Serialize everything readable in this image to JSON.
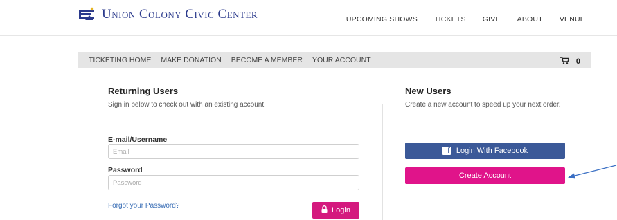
{
  "header": {
    "logo_text": "Union Colony Civic Center",
    "brand_color": "#2b3a8c",
    "nav": [
      "UPCOMING SHOWS",
      "TICKETS",
      "GIVE",
      "ABOUT",
      "VENUE"
    ]
  },
  "ticket_bar": {
    "items": [
      "TICKETING HOME",
      "MAKE DONATION",
      "BECOME A MEMBER",
      "YOUR ACCOUNT"
    ],
    "cart_icon": "cart-icon",
    "cart_count": "0"
  },
  "returning": {
    "title": "Returning Users",
    "subtitle": "Sign in below to check out with an existing account.",
    "email_label": "E-mail/Username",
    "email_placeholder": "Email",
    "password_label": "Password",
    "password_placeholder": "Password",
    "forgot_label": "Forgot your Password?",
    "login_label": "Login",
    "login_icon": "lock-icon",
    "accent_color": "#d4197e"
  },
  "new_users": {
    "title": "New Users",
    "subtitle": "Create a new account to speed up your next order.",
    "facebook_label": "Login With Facebook",
    "facebook_color": "#3b5998",
    "create_label": "Create Account",
    "create_color": "#e0148a"
  },
  "annotation": {
    "arrow_icon": "arrow-left-icon",
    "arrow_color": "#3a6fc4"
  }
}
